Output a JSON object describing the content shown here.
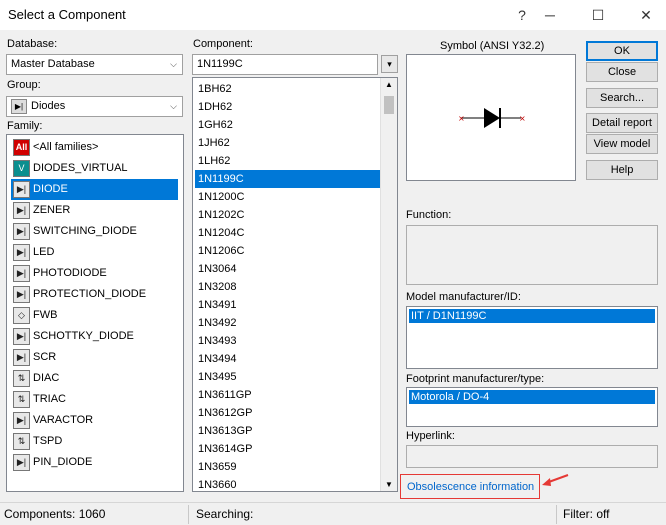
{
  "window": {
    "title": "Select a Component",
    "help_glyph": "?",
    "close_glyph": "✕",
    "minimize_glyph": "─",
    "maximize_glyph": "☐"
  },
  "database": {
    "label": "Database:",
    "value": "Master Database"
  },
  "group": {
    "label": "Group:",
    "value": "Diodes"
  },
  "family": {
    "label": "Family:",
    "items": [
      {
        "label": "<All families>",
        "icon": "all-families-icon",
        "glyph": "All"
      },
      {
        "label": "DIODES_VIRTUAL",
        "icon": "diode-virtual-icon",
        "glyph": "V"
      },
      {
        "label": "DIODE",
        "icon": "diode-icon",
        "glyph": "▶|",
        "selected": true
      },
      {
        "label": "ZENER",
        "icon": "zener-icon",
        "glyph": "▶|"
      },
      {
        "label": "SWITCHING_DIODE",
        "icon": "switching-diode-icon",
        "glyph": "▶|"
      },
      {
        "label": "LED",
        "icon": "led-icon",
        "glyph": "▶|"
      },
      {
        "label": "PHOTODIODE",
        "icon": "photodiode-icon",
        "glyph": "▶|"
      },
      {
        "label": "PROTECTION_DIODE",
        "icon": "protection-diode-icon",
        "glyph": "▶|"
      },
      {
        "label": "FWB",
        "icon": "fwb-icon",
        "glyph": "◇"
      },
      {
        "label": "SCHOTTKY_DIODE",
        "icon": "schottky-icon",
        "glyph": "▶|"
      },
      {
        "label": "SCR",
        "icon": "scr-icon",
        "glyph": "▶|"
      },
      {
        "label": "DIAC",
        "icon": "diac-icon",
        "glyph": "⇅"
      },
      {
        "label": "TRIAC",
        "icon": "triac-icon",
        "glyph": "⇅"
      },
      {
        "label": "VARACTOR",
        "icon": "varactor-icon",
        "glyph": "▶|"
      },
      {
        "label": "TSPD",
        "icon": "tspd-icon",
        "glyph": "⇅"
      },
      {
        "label": "PIN_DIODE",
        "icon": "pin-diode-icon",
        "glyph": "▶|"
      }
    ]
  },
  "component": {
    "label": "Component:",
    "value": "1N1199C",
    "items": [
      "1BH62",
      "1DH62",
      "1GH62",
      "1JH62",
      "1LH62",
      "1N1199C",
      "1N1200C",
      "1N1202C",
      "1N1204C",
      "1N1206C",
      "1N3064",
      "1N3208",
      "1N3491",
      "1N3492",
      "1N3493",
      "1N3494",
      "1N3495",
      "1N3611GP",
      "1N3612GP",
      "1N3613GP",
      "1N3614GP",
      "1N3659",
      "1N3660"
    ],
    "selected_index": 5
  },
  "symbol": {
    "label": "Symbol (ANSI Y32.2)"
  },
  "buttons": {
    "ok": "OK",
    "close": "Close",
    "search": "Search...",
    "detail_report": "Detail report",
    "view_model": "View model",
    "help": "Help"
  },
  "function": {
    "label": "Function:",
    "value": ""
  },
  "model": {
    "label": "Model manufacturer/ID:",
    "value": "IIT / D1N1199C"
  },
  "footprint": {
    "label": "Footprint manufacturer/type:",
    "value": "Motorola / DO-4"
  },
  "hyperlink": {
    "label": "Hyperlink:",
    "value": ""
  },
  "obsolescence": {
    "label": "Obsolescence information"
  },
  "status": {
    "components": "Components: 1060",
    "searching": "Searching:",
    "filter": "Filter: off"
  },
  "colors": {
    "selection": "#0078d7",
    "annotation_red": "#e53935",
    "link": "#0066cc"
  }
}
